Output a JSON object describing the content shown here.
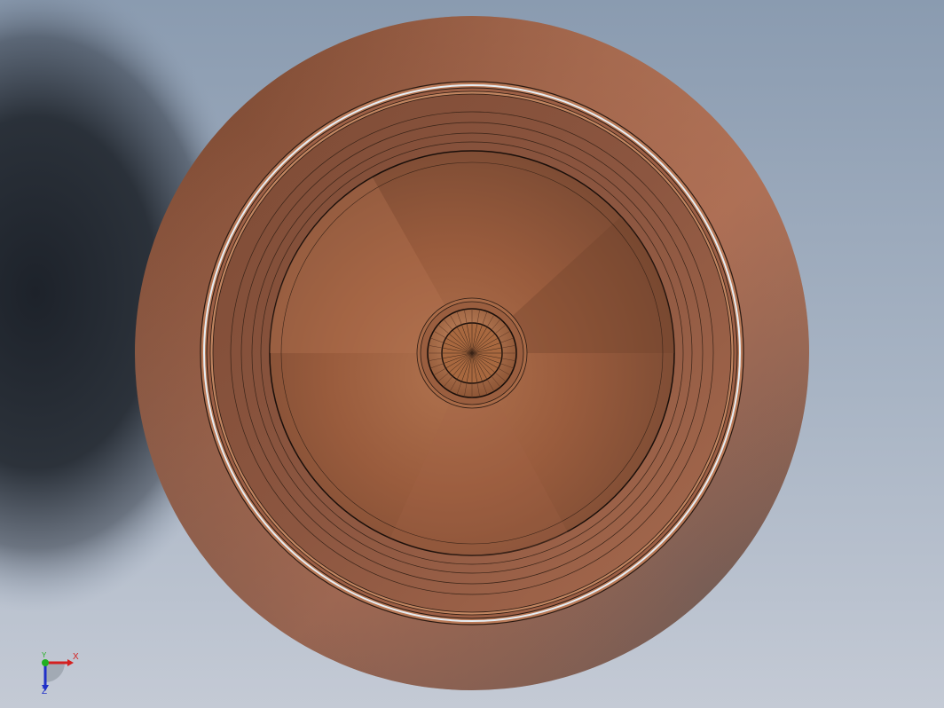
{
  "viewport": {
    "background_gradient": [
      "#8e9fb3",
      "#a9b6c6",
      "#c2c9d4"
    ],
    "shadow_color": "#2a3038"
  },
  "model": {
    "part": "bowl",
    "material_color": "#a8674a",
    "edge_color": "#2b1a12",
    "rim_highlight_color": "#e8eef4"
  },
  "triad": {
    "x_label": "X",
    "y_label": "Y",
    "z_label": "Z",
    "x_color": "#d42020",
    "y_color": "#20b020",
    "z_color": "#2030c8"
  }
}
